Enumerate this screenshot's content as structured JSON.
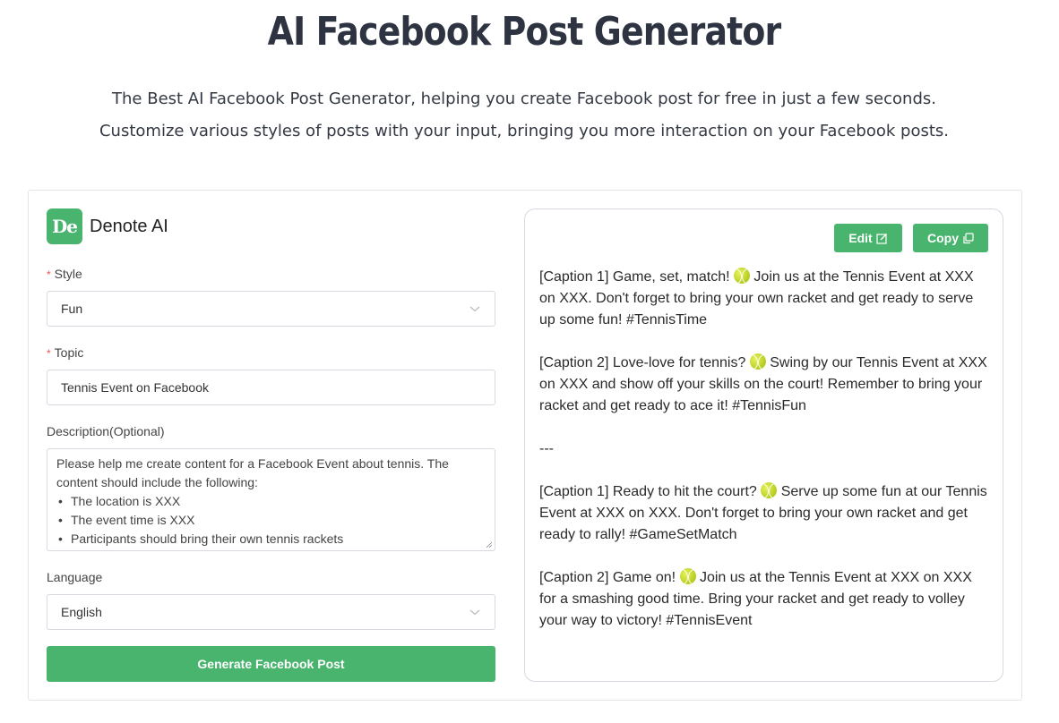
{
  "header": {
    "title": "AI Facebook Post Generator",
    "subtitle_line1": "The Best AI Facebook Post Generator, helping you create Facebook post for free in just a few seconds.",
    "subtitle_line2": "Customize various styles of posts with your input, bringing you more interaction on your Facebook posts."
  },
  "brand": {
    "logo_text": "De",
    "name": "Denote AI",
    "color": "#48b46d"
  },
  "form": {
    "style": {
      "label": "Style",
      "required_mark": "*",
      "value": "Fun"
    },
    "topic": {
      "label": "Topic",
      "required_mark": "*",
      "value": "Tennis Event on Facebook"
    },
    "description": {
      "label": "Description(Optional)",
      "intro": "Please help me create content for a Facebook Event about tennis. The content should include the following:",
      "bullet_char": "•",
      "bullets": [
        "The location is XXX",
        "The event time is XXX",
        "Participants should bring their own tennis rackets"
      ]
    },
    "language": {
      "label": "Language",
      "value": "English"
    },
    "generate_label": "Generate Facebook Post"
  },
  "output": {
    "edit_label": "Edit",
    "copy_label": "Copy",
    "paragraphs": [
      {
        "before": "[Caption 1] Game, set, match! ",
        "emoji": "tennis-ball",
        "after": " Join us at the Tennis Event at XXX on XXX. Don't forget to bring your own racket and get ready to serve up some fun! #TennisTime"
      },
      {
        "before": "[Caption 2] Love-love for tennis? ",
        "emoji": "tennis-ball",
        "after": " Swing by our Tennis Event at XXX on XXX and show off your skills on the court! Remember to bring your racket and get ready to ace it! #TennisFun"
      },
      {
        "before": "---",
        "emoji": null,
        "after": ""
      },
      {
        "before": "[Caption 1] Ready to hit the court? ",
        "emoji": "tennis-ball",
        "after": " Serve up some fun at our Tennis Event at XXX on XXX. Don't forget to bring your own racket and get ready to rally! #GameSetMatch"
      },
      {
        "before": "[Caption 2] Game on! ",
        "emoji": "tennis-ball",
        "after": " Join us at the Tennis Event at XXX on XXX for a smashing good time. Bring your racket and get ready to volley your way to victory! #TennisEvent"
      }
    ]
  }
}
